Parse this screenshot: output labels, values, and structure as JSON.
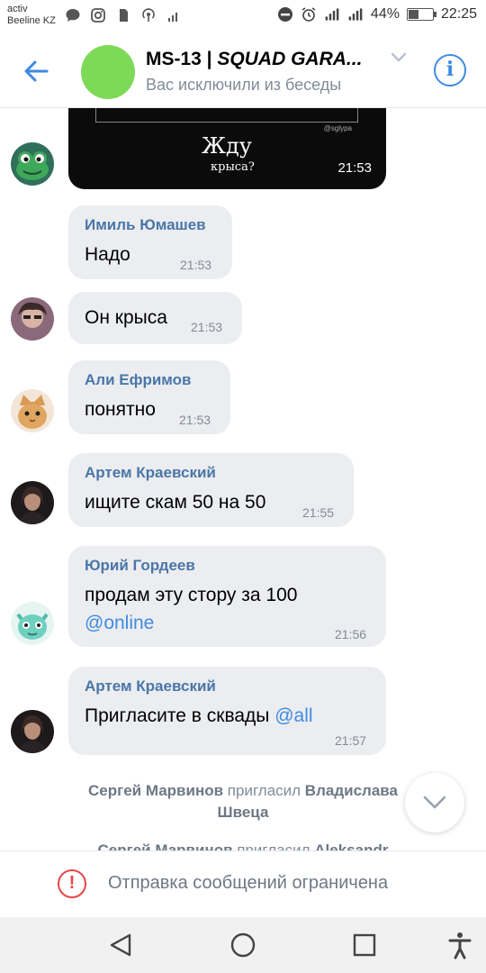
{
  "status_bar": {
    "carrier_line1": "activ",
    "carrier_line2": "Beeline KZ",
    "battery_percent": "44%",
    "battery_level": 0.44,
    "time": "22:25"
  },
  "header": {
    "title_prefix": "MS-13 | ",
    "title_italic": "SQUAD GARA...",
    "subtitle": "Вас исключили из беседы",
    "avatar_color": "#7ed957"
  },
  "photo_message": {
    "caption_top": "Жду",
    "caption_bottom": "крыса?",
    "watermark": "@sglypa",
    "time": "21:53"
  },
  "messages": [
    {
      "name": "Имиль Юмашев",
      "text": "Надо",
      "time": "21:53"
    },
    {
      "name": "",
      "text": "Он крыса",
      "time": "21:53"
    },
    {
      "name": "Али Ефримов",
      "text": "понятно",
      "time": "21:53"
    },
    {
      "name": "Артем Краевский",
      "text": "ищите скам 50 на 50",
      "time": "21:55"
    },
    {
      "name": "Юрий Гордеев",
      "text": "продам эту стору за 100",
      "mention": "@online",
      "time": "21:56"
    },
    {
      "name": "Артем Краевский",
      "text": "Пригласите в сквады ",
      "mention": "@all",
      "time": "21:57"
    }
  ],
  "service_messages": [
    {
      "actor": "Сергей Марвинов",
      "action": " пригласил ",
      "target": "Владислава",
      "target_line2": "Швеца"
    },
    {
      "actor": "Сергей Марвинов",
      "action": " пригласил ",
      "target": "Aleksandr"
    }
  ],
  "restricted": {
    "text": "Отправка сообщений ограничена",
    "color": "#e64646"
  },
  "colors": {
    "accent": "#3f8ae0",
    "name": "#4a76a8",
    "bubble": "#ebedf0",
    "muted": "#818c99"
  }
}
